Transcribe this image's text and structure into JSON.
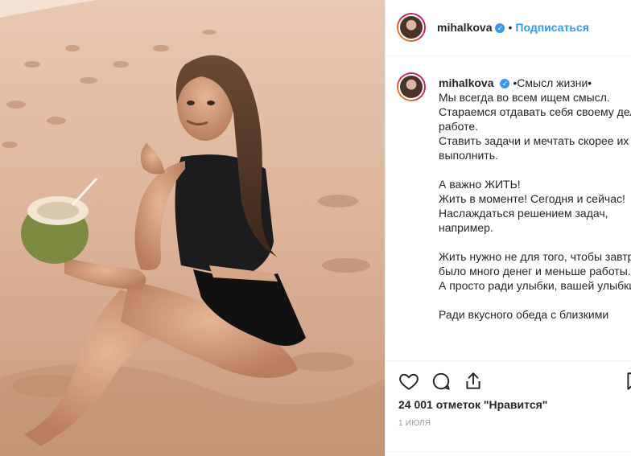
{
  "post": {
    "username": "mihalkova",
    "follow_label": "Подписаться",
    "caption_title": "•Смысл жизни•",
    "caption_body": "Мы всегда во всем ищем смысл.\nСтараемся отдавать себя своему делу, работе.\nСтавить задачи и мечтать скорее их выполнить.\n\nА важно ЖИТЬ!\nЖить в моменте! Сегодня и сейчас!\nНаслаждаться решением задач, например.\n\nЖить нужно не для того, чтобы завтра было много денег и меньше работы.\nА просто ради улыбки, вашей улыбки!\n\nРади вкусного обеда с близкими",
    "likes": "24 001 отметок \"Нравится\"",
    "date": "1 ИЮЛЯ"
  },
  "icons": {
    "like": "heart-icon",
    "comment": "comment-icon",
    "share": "share-icon",
    "save": "bookmark-icon",
    "verified": "verified-badge-icon"
  },
  "colors": {
    "accent": "#3897f0",
    "text": "#262626",
    "muted": "#999999"
  }
}
